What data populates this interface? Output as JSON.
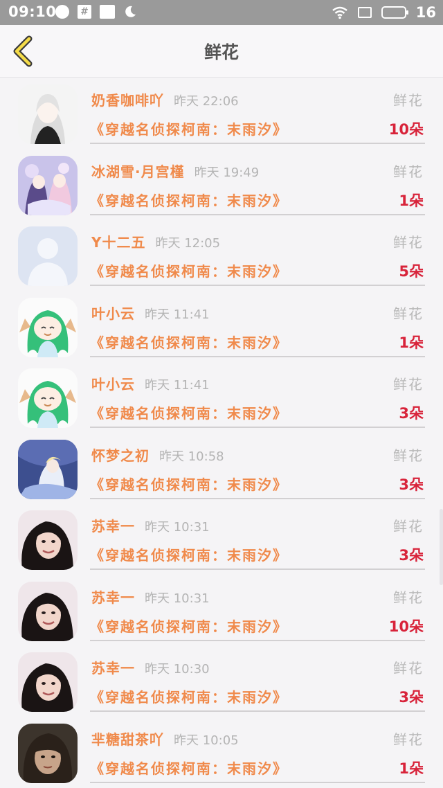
{
  "status_bar": {
    "time": "09:10",
    "battery": "16",
    "square_icon_text": "#"
  },
  "nav": {
    "title": "鲜花"
  },
  "items": [
    {
      "name": "奶香咖啡吖",
      "time": "昨天 22:06",
      "type": "鲜花",
      "book": "《穿越名侦探柯南：末雨汐》",
      "count": "10朵",
      "avatar": "white-hair-girl"
    },
    {
      "name": "冰湖雪·月宫槿",
      "time": "昨天 19:49",
      "type": "鲜花",
      "book": "《穿越名侦探柯南：末雨汐》",
      "count": "1朵",
      "avatar": "anime-duo"
    },
    {
      "name": "Y十二五",
      "time": "昨天 12:05",
      "type": "鲜花",
      "book": "《穿越名侦探柯南：末雨汐》",
      "count": "5朵",
      "avatar": "default-silhouette"
    },
    {
      "name": "叶小云",
      "time": "昨天 11:41",
      "type": "鲜花",
      "book": "《穿越名侦探柯南：末雨汐》",
      "count": "1朵",
      "avatar": "green-hair-chibi"
    },
    {
      "name": "叶小云",
      "time": "昨天 11:41",
      "type": "鲜花",
      "book": "《穿越名侦探柯南：末雨汐》",
      "count": "3朵",
      "avatar": "green-hair-chibi"
    },
    {
      "name": "怀梦之初",
      "time": "昨天 10:58",
      "type": "鲜花",
      "book": "《穿越名侦探柯南：末雨汐》",
      "count": "3朵",
      "avatar": "anime-fantasy"
    },
    {
      "name": "苏幸一",
      "time": "昨天 10:31",
      "type": "鲜花",
      "book": "《穿越名侦探柯南：末雨汐》",
      "count": "3朵",
      "avatar": "photo-girl"
    },
    {
      "name": "苏幸一",
      "time": "昨天 10:31",
      "type": "鲜花",
      "book": "《穿越名侦探柯南：末雨汐》",
      "count": "10朵",
      "avatar": "photo-girl"
    },
    {
      "name": "苏幸一",
      "time": "昨天 10:30",
      "type": "鲜花",
      "book": "《穿越名侦探柯南：末雨汐》",
      "count": "3朵",
      "avatar": "photo-girl"
    },
    {
      "name": "芈糖甜茶吖",
      "time": "昨天 10:05",
      "type": "鲜花",
      "book": "《穿越名侦探柯南：末雨汐》",
      "count": "1朵",
      "avatar": "photo-dark"
    }
  ]
}
